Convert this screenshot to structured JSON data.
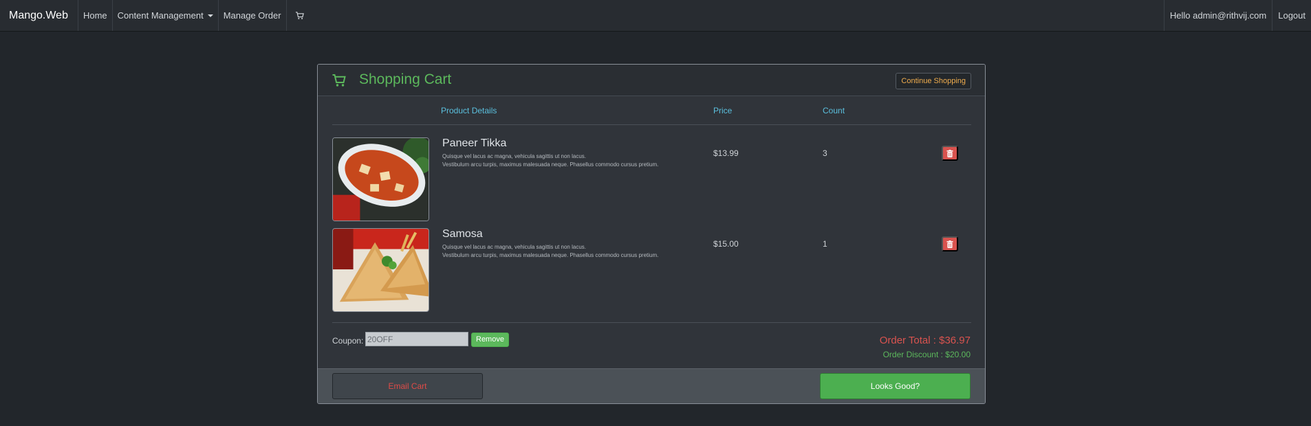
{
  "navbar": {
    "brand": "Mango.Web",
    "items": [
      {
        "label": "Home"
      },
      {
        "label": "Content Management"
      },
      {
        "label": "Manage Order"
      }
    ],
    "cart_icon": "cart-icon",
    "greeting": "Hello admin@rithvij.com",
    "logout": "Logout"
  },
  "cart": {
    "title": "Shopping Cart",
    "title_icon": "cart-icon",
    "continue_label": "Continue Shopping",
    "columns": {
      "details": "Product Details",
      "price": "Price",
      "count": "Count"
    },
    "items": [
      {
        "name": "Paneer Tikka",
        "desc_line1": "Quisque vel lacus ac magna, vehicula sagittis ut non lacus.",
        "desc_line2": "Vestibulum arcu turpis, maximus malesuada neque. Phasellus commodo cursus pretium.",
        "price": "$13.99",
        "count": "3",
        "delete_icon": "trash-icon"
      },
      {
        "name": "Samosa",
        "desc_line1": "Quisque vel lacus ac magna, vehicula sagittis ut non lacus.",
        "desc_line2": "Vestibulum arcu turpis, maximus malesuada neque. Phasellus commodo cursus pretium.",
        "price": "$15.00",
        "count": "1",
        "delete_icon": "trash-icon"
      }
    ],
    "coupon": {
      "label": "Coupon:",
      "value": "20OFF",
      "remove_label": "Remove"
    },
    "order_total": "Order Total : $36.97",
    "order_discount": "Order Discount : $20.00",
    "footer": {
      "email_label": "Email Cart",
      "confirm_label": "Looks Good?"
    }
  },
  "colors": {
    "accent_green": "#5cb85c",
    "danger_red": "#d9534f",
    "info_blue": "#5bc0de",
    "warning_orange": "#f0ad4e"
  }
}
